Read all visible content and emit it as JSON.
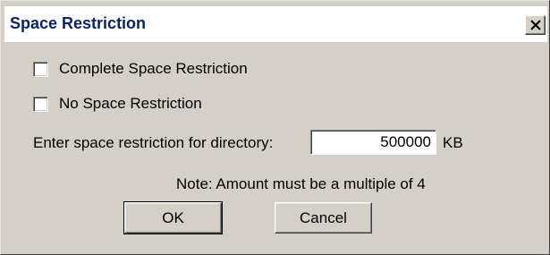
{
  "dialog": {
    "title": "Space Restriction",
    "close_label": "X"
  },
  "options": {
    "complete_label": "Complete Space Restriction",
    "complete_checked": false,
    "none_label": "No Space Restriction",
    "none_checked": false
  },
  "restriction": {
    "label": "Enter space restriction for directory:",
    "value": "500000",
    "unit": "KB"
  },
  "note": "Note: Amount must be a multiple of 4",
  "buttons": {
    "ok_label": "OK",
    "cancel_label": "Cancel"
  }
}
